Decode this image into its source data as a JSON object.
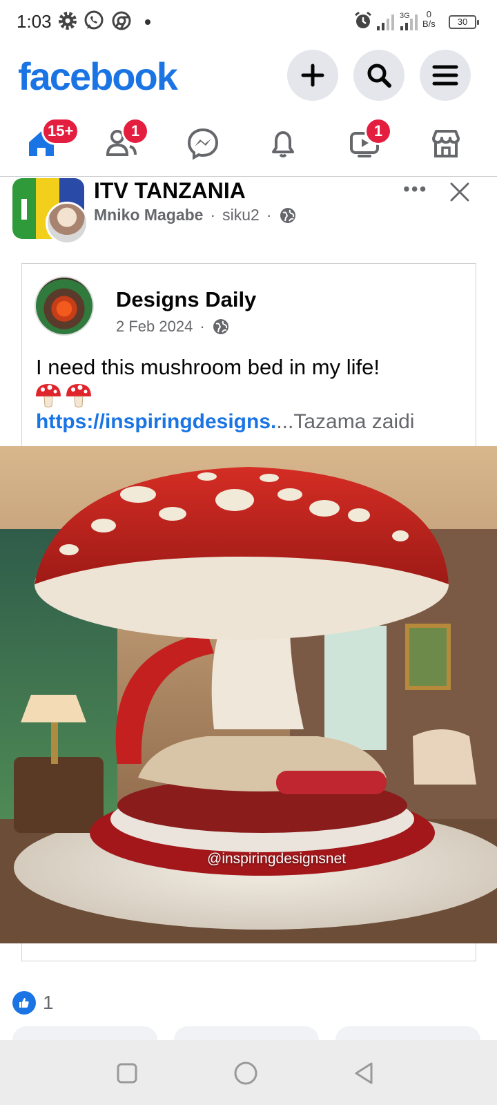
{
  "status_bar": {
    "time": "1:03",
    "net_speed_value": "0",
    "net_speed_unit": "B/s",
    "battery": "30",
    "icons": [
      "gear-icon",
      "whatsapp-icon",
      "chrome-icon",
      "alarm-icon",
      "signal-icon",
      "network-3g-icon",
      "battery-icon"
    ]
  },
  "header": {
    "logo": "facebook",
    "brand_color": "#1b74e4",
    "buttons": [
      "add-icon",
      "search-icon",
      "menu-icon"
    ]
  },
  "nav_tabs": [
    {
      "name": "home",
      "icon": "home-icon",
      "badge": "15+"
    },
    {
      "name": "friends",
      "icon": "friends-icon",
      "badge": "1"
    },
    {
      "name": "messenger",
      "icon": "messenger-icon",
      "badge": ""
    },
    {
      "name": "notifications",
      "icon": "bell-icon",
      "badge": ""
    },
    {
      "name": "video",
      "icon": "video-icon",
      "badge": "1"
    },
    {
      "name": "marketplace",
      "icon": "marketplace-icon",
      "badge": ""
    }
  ],
  "post": {
    "page_name": "ITV TANZANIA",
    "author": "Mniko Magabe",
    "time": "siku2",
    "separator": "·",
    "audience_icon": "globe-icon"
  },
  "shared": {
    "name": "Designs Daily",
    "date": "2 Feb 2024",
    "separator": "·",
    "text": "I need this mushroom bed in my life!",
    "emoji": [
      "mushroom-icon",
      "mushroom-icon"
    ],
    "link": "https://inspiringdesigns.",
    "see_more": "...Tazama zaidi",
    "image_watermark": "@inspiringdesignsnet"
  },
  "reactions": {
    "count": "1",
    "icon": "like-icon"
  },
  "android_nav": [
    "recent-apps-icon",
    "home-circle-icon",
    "back-icon"
  ]
}
